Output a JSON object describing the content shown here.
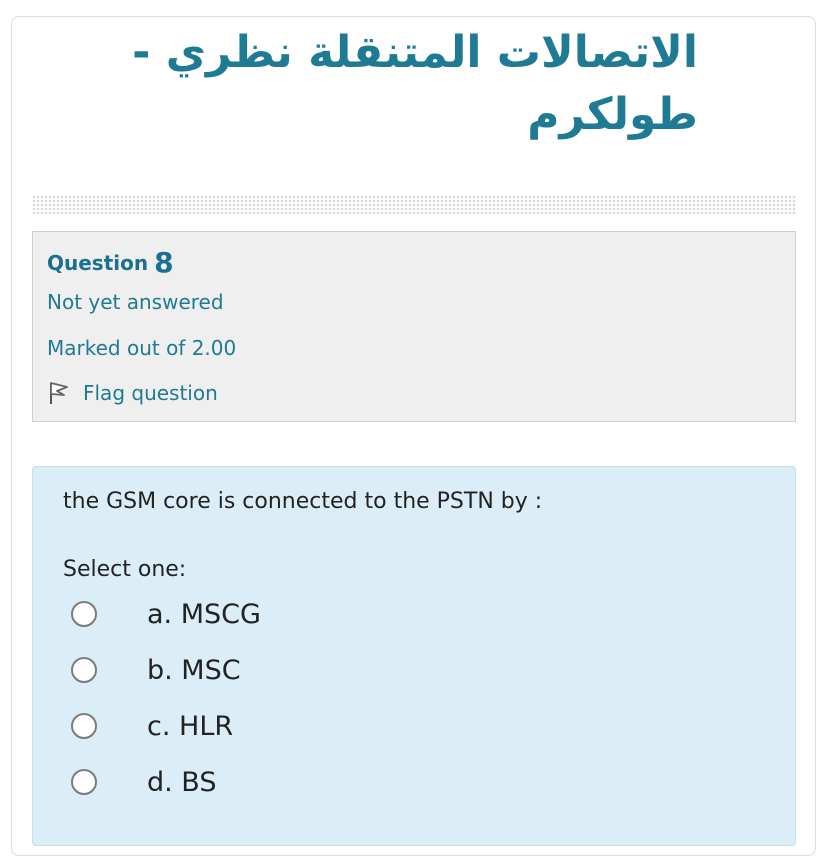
{
  "course": {
    "title": "الاتصالات المتنقلة نظري - طولكرم"
  },
  "info": {
    "question_label": "Question",
    "question_number": "8",
    "state": "Not yet answered",
    "grade": "Marked out of 2.00",
    "flag_label": "Flag question",
    "flag_icon": "flag-icon"
  },
  "question": {
    "text": "the GSM core is connected to the PSTN by :",
    "prompt": "Select one:",
    "options": [
      {
        "label": "a. MSCG",
        "selected": false
      },
      {
        "label": "b. MSC",
        "selected": false
      },
      {
        "label": "c. HLR",
        "selected": false
      },
      {
        "label": "d. BS",
        "selected": false
      }
    ]
  },
  "colors": {
    "accent": "#1f7a93",
    "info_bg": "#efefef",
    "formulation_bg": "#dbeef7"
  }
}
